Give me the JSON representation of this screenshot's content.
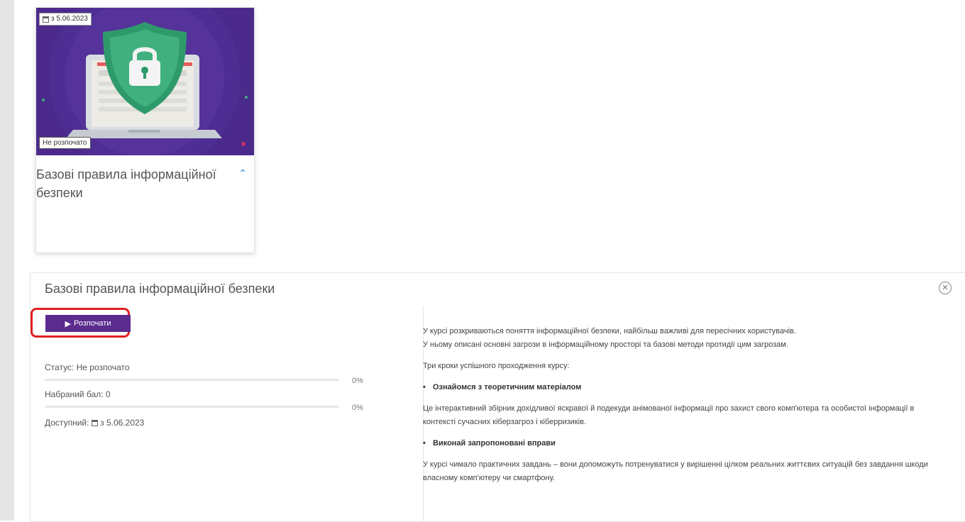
{
  "card": {
    "date_label": "з 5.06.2023",
    "status_label": "Не розпочато",
    "title": "Базові правила інформаційної безпеки"
  },
  "panel": {
    "title": "Базові правила інформаційної безпеки",
    "start_label": "Розпочати",
    "status_text": "Статус: Не розпочато",
    "status_progress": 0,
    "status_percent": "0%",
    "score_text": "Набраний бал: 0",
    "score_progress": 0,
    "score_percent": "0%",
    "available_label": "Доступний:",
    "available_value": "з 5.06.2023"
  },
  "description": {
    "intro_1": "У курсі розкриваються поняття інформаційної безпеки, найбільш важливі для пересічних користувачів.",
    "intro_2": "У ньому описані основні загрози в інформаційному просторі та базові методи протидії цим загрозам.",
    "steps_heading": "Три кроки успішного проходження курсу:",
    "step_1": "Ознайомся з теоретичним матеріалом",
    "step_1_text": "Це інтерактивний збірник дохідливої яскравої й подекуди анімованої інформації про захист свого комп'ютера та особистої інформації в контексті сучасних кіберзагроз і кіберризиків.",
    "step_2": "Виконай запропоновані вправи",
    "step_2_text": "У курсі чимало практичних завдань – вони допоможуть потренуватися у вирішенні цілком реальних життєвих ситуацій без завдання шкоди власному комп'ютеру чи смартфону."
  },
  "colors": {
    "accent": "#5b2b8f",
    "highlight": "#e02020",
    "link": "#2a7fc1"
  },
  "icons": {
    "calendar": "calendar-icon",
    "play": "play-icon",
    "close": "close-circle-icon",
    "collapse": "chevron-up-icon"
  }
}
